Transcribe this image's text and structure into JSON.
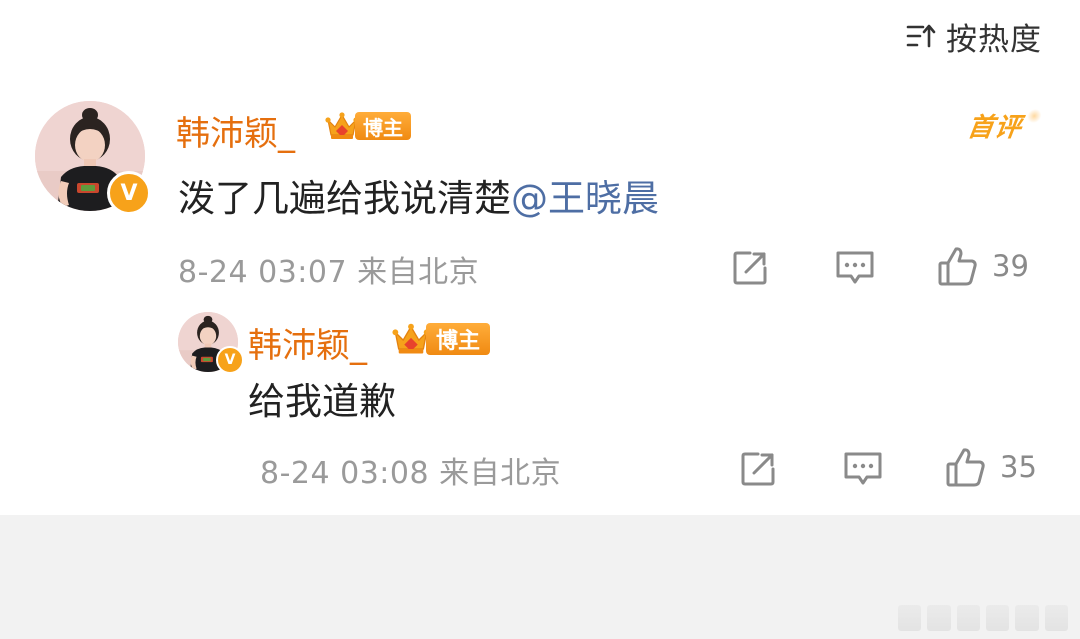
{
  "sort": {
    "label": "按热度",
    "icon": "sort-hot-icon"
  },
  "comments": [
    {
      "username": "韩沛颖_",
      "badge_label": "博主",
      "first_comment_label": "首评",
      "content_text": "泼了几遍给我说清楚",
      "mention": "@王晓晨",
      "date": "8-24 03:07",
      "location": "来自北京",
      "like_count": "39",
      "verified_mark": "V"
    },
    {
      "username": "韩沛颖_",
      "badge_label": "博主",
      "content_text": "给我道歉",
      "date": "8-24 03:08",
      "location": "来自北京",
      "like_count": "35",
      "verified_mark": "V"
    }
  ],
  "colors": {
    "username": "#e56f0e",
    "mention": "#4e6ea4",
    "meta": "#9a9a9a",
    "verified": "#f7a21a",
    "badge": "#f08a12",
    "bottom_background": "#f2f2f2"
  }
}
